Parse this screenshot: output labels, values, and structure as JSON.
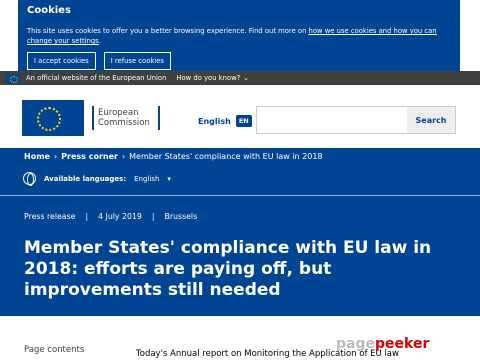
{
  "cookie": {
    "title": "Cookies",
    "text": "This site uses cookies to offer you a better browsing experience. Find out more on",
    "link": "how we use cookies and how you can change your settings",
    "period": ".",
    "accept": "I accept cookies",
    "refuse": "I refuse cookies"
  },
  "eubanner": {
    "official": "An official website of the European Union",
    "know": "How do you know?"
  },
  "header": {
    "logo_line1": "European",
    "logo_line2": "Commission",
    "language": "English",
    "lang_code": "EN",
    "search_placeholder": "",
    "search_button": "Search"
  },
  "breadcrumb": {
    "home": "Home",
    "press": "Press corner",
    "current": "Member States' compliance with EU law in 2018"
  },
  "languages": {
    "label": "Available languages:",
    "value": "English"
  },
  "meta": {
    "type": "Press release",
    "date": "4 July 2019",
    "place": "Brussels"
  },
  "title": "Member States' compliance with EU law in 2018: efforts are paying off, but improvements still needed",
  "page_contents": "Page contents",
  "intro": "Today's Annual report on Monitoring the Application of EU law",
  "watermark": {
    "a": "page",
    "b": "peeker"
  },
  "colors": {
    "brand": "#004494",
    "accent": "#ffd617",
    "grey": "#404040"
  }
}
